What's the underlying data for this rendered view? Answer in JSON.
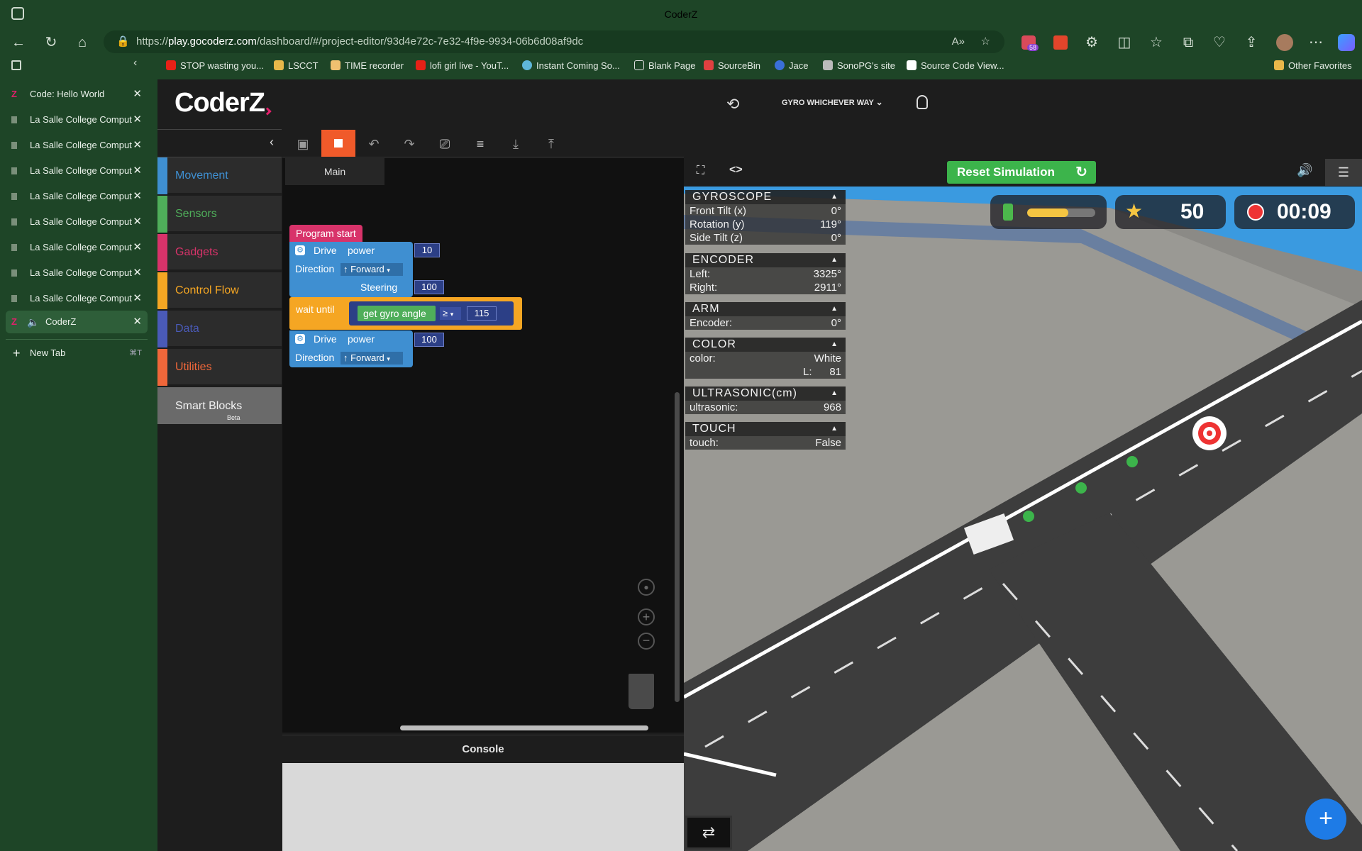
{
  "browser": {
    "window_title": "CoderZ",
    "url_prefix": "https://",
    "url_domain": "play.gocoderz.com",
    "url_path": "/dashboard/#/project-editor/93d4e72c-7e32-4f9e-9934-06b6d08af9dc",
    "badge_count": "58",
    "bookmarks": [
      {
        "label": "STOP wasting you..."
      },
      {
        "label": "LSCCT"
      },
      {
        "label": "TIME recorder"
      },
      {
        "label": "lofi girl live - YouT..."
      },
      {
        "label": "Instant Coming So..."
      },
      {
        "label": "Blank Page"
      },
      {
        "label": "SourceBin"
      },
      {
        "label": "Jace"
      },
      {
        "label": "SonoPG's site"
      },
      {
        "label": "Source Code View..."
      },
      {
        "label": "Other Favorites"
      }
    ],
    "tabs": [
      {
        "label": "Code: Hello World"
      },
      {
        "label": "La Salle College Comput"
      },
      {
        "label": "La Salle College Comput"
      },
      {
        "label": "La Salle College Comput"
      },
      {
        "label": "La Salle College Comput"
      },
      {
        "label": "La Salle College Comput"
      },
      {
        "label": "La Salle College Comput"
      },
      {
        "label": "La Salle College Comput"
      },
      {
        "label": "La Salle College Comput"
      },
      {
        "label": "CoderZ"
      }
    ],
    "new_tab_label": "New Tab",
    "new_tab_shortcut": "⌘T"
  },
  "app": {
    "logo": "CoderZ",
    "mission_label": "GYRO WHICHEVER WAY",
    "categories": [
      {
        "label": "Movement",
        "color": "#3f8fd1"
      },
      {
        "label": "Sensors",
        "color": "#4fae5a"
      },
      {
        "label": "Gadgets",
        "color": "#d8336a"
      },
      {
        "label": "Control Flow",
        "color": "#f5a623"
      },
      {
        "label": "Data",
        "color": "#4a5ab8"
      },
      {
        "label": "Utilities",
        "color": "#f0673a"
      }
    ],
    "smart_blocks": {
      "label": "Smart Blocks",
      "badge": "Beta"
    },
    "main_tab": "Main",
    "console_label": "Console",
    "reset_label": "Reset Simulation"
  },
  "program": {
    "start": "Program start",
    "drive1": {
      "label": "Drive",
      "power_label": "power",
      "power": "10",
      "direction_label": "Direction",
      "direction": "↑ Forward",
      "steering_label": "Steering",
      "steering": "100"
    },
    "wait": {
      "label": "wait until",
      "sensor": "get gyro angle",
      "op": "≥",
      "value": "115"
    },
    "drive2": {
      "label": "Drive",
      "power_label": "power",
      "power": "100",
      "direction_label": "Direction",
      "direction": "↑ Forward"
    }
  },
  "sensors": {
    "gyroscope": {
      "title": "GYROSCOPE",
      "rows": [
        [
          "Front Tilt (x)",
          "0°"
        ],
        [
          "Rotation (y)",
          "119°"
        ],
        [
          "Side Tilt (z)",
          "0°"
        ]
      ]
    },
    "encoder": {
      "title": "ENCODER",
      "rows": [
        [
          "Left:",
          "3325°"
        ],
        [
          "Right:",
          "2911°"
        ]
      ]
    },
    "arm": {
      "title": "ARM",
      "rows": [
        [
          "Encoder:",
          "0°"
        ]
      ]
    },
    "color": {
      "title": "COLOR",
      "rows": [
        [
          "color:",
          "White"
        ],
        [
          "L:",
          "81"
        ]
      ]
    },
    "ultrasonic": {
      "title": "ULTRASONIC(cm)",
      "rows": [
        [
          "ultrasonic:",
          "968"
        ]
      ]
    },
    "touch": {
      "title": "TOUCH",
      "rows": [
        [
          "touch:",
          "False"
        ]
      ]
    }
  },
  "hud": {
    "battery_level": 0.6,
    "score": "50",
    "timer": "00:09"
  }
}
